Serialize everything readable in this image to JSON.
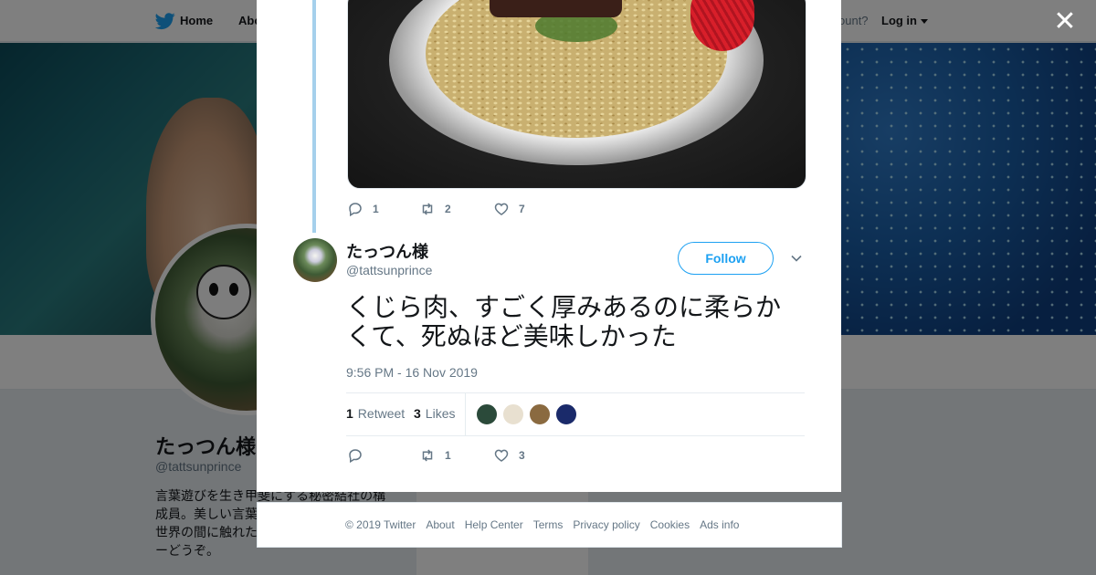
{
  "nav": {
    "home_label": "Home",
    "about_label": "Abo",
    "account_text": "ccount?",
    "login_label": "Log in"
  },
  "profile": {
    "name": "たっつん様",
    "handle": "@tattsunprince",
    "bio": "言葉遊びを生き甲斐にする秘密結社の構成員。美しい言葉 けで幸せになれる す。世界の間に触れたければお気軽にフォローどうぞ。",
    "ads_info": "Ads info"
  },
  "close_label": "✕",
  "previous_tweet": {
    "media_alt": "Photo of rice dish with whale meat and pickled ginger",
    "reply_count": "1",
    "retweet_count": "2",
    "like_count": "7"
  },
  "tweet": {
    "author_name": "たっつん様",
    "author_handle": "@tattsunprince",
    "follow_label": "Follow",
    "text": "くじら肉、すごく厚みあるのに柔らかくて、死ぬほど美味しかった",
    "timestamp": "9:56 PM - 16 Nov 2019",
    "retweets_num": "1",
    "retweets_label": "Retweet",
    "likes_num": "3",
    "likes_label": "Likes",
    "likers": [
      {
        "color": "#2b4a3a"
      },
      {
        "color": "#e8e0d0"
      },
      {
        "color": "#8a6a40"
      },
      {
        "color": "#1a2a6a"
      }
    ],
    "reply_count": "",
    "retweet_count": "1",
    "like_count": "3"
  },
  "footer": {
    "links": [
      "© 2019 Twitter",
      "About",
      "Help Center",
      "Terms",
      "Privacy policy",
      "Cookies",
      "Ads info"
    ]
  },
  "colors": {
    "brand": "#1da1f2",
    "text_primary": "#14171a",
    "text_secondary": "#657786",
    "thread_line": "#a5d0ec"
  },
  "icons": {
    "logo": "twitter-bird-icon",
    "reply": "reply-icon",
    "retweet": "retweet-icon",
    "like": "heart-icon",
    "chevron": "chevron-down-icon",
    "close": "close-icon"
  }
}
